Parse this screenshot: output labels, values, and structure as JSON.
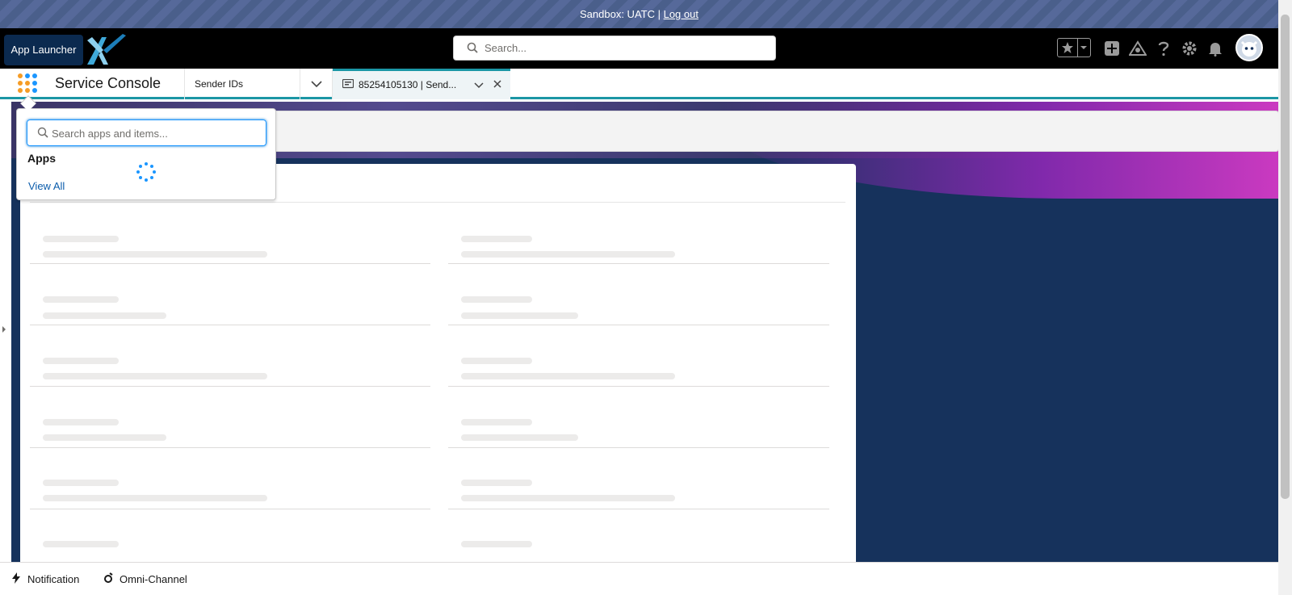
{
  "sandbox": {
    "label": "Sandbox: UATC | ",
    "logout": "Log out"
  },
  "header": {
    "app_launcher_tooltip": "App Launcher",
    "search_placeholder": "Search...",
    "icons": [
      "favorites-star-icon",
      "favorites-dropdown-icon",
      "global-actions-plus-icon",
      "trailhead-icon",
      "help-icon",
      "setup-gear-icon",
      "notifications-bell-icon",
      "user-avatar"
    ]
  },
  "nav": {
    "app_name": "Service Console",
    "object_tab": "Sender IDs",
    "workspace_tab": "85254105130 | Send..."
  },
  "launcher": {
    "search_placeholder": "Search apps and items...",
    "apps_heading": "Apps",
    "view_all": "View All"
  },
  "utility_bar": {
    "items": [
      {
        "label": "Notification",
        "icon": "lightning-icon"
      },
      {
        "label": "Omni-Channel",
        "icon": "omni-channel-icon"
      }
    ]
  },
  "colors": {
    "accent": "#1b96a5",
    "brand_dark": "#16325c",
    "link": "#0b5cab"
  }
}
